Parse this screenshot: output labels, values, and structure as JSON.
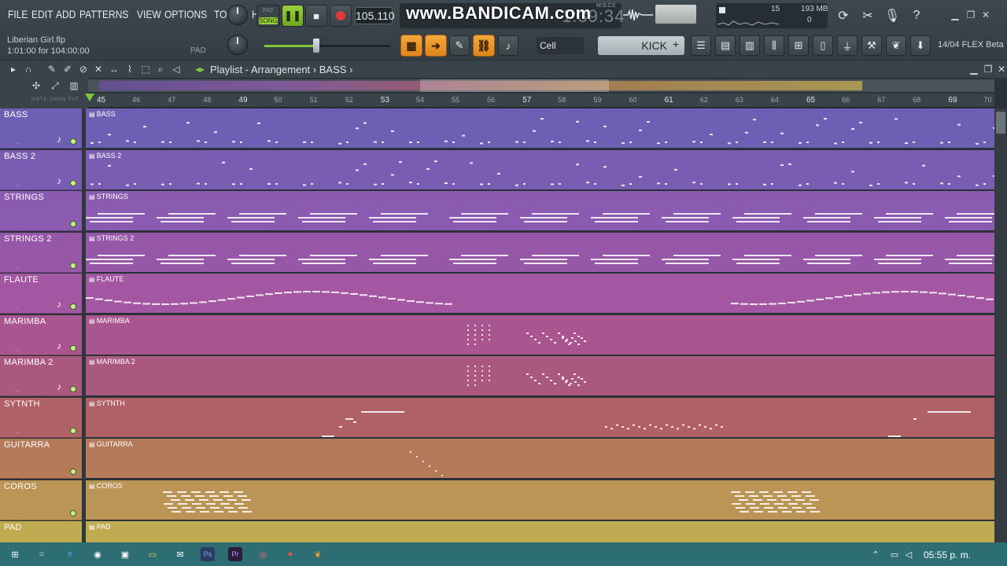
{
  "menu": [
    "FILE",
    "EDIT",
    "ADD",
    "PATTERNS",
    "VIEW",
    "OPTIONS",
    "TOOLS",
    "HELP"
  ],
  "hint": {
    "file": "Liberian Girl.flp",
    "time": "1:01:00 for 104:00:00"
  },
  "pad_label": "PAD",
  "transport": {
    "pat": "PAT",
    "song": "SONG",
    "tempo": "105.110"
  },
  "recorder_watermark": "www.BANDICAM.com",
  "time_display": {
    "digits": "1:39:34",
    "small": "M:S:CS"
  },
  "cpu": {
    "value": "15",
    "memory": "193 MB",
    "polyphony": "0"
  },
  "snap": "Cell",
  "pattern": {
    "name": "KICK"
  },
  "version": "14/04  FLEX Beta",
  "playlist": {
    "title": "Playlist - Arrangement",
    "separator": "›",
    "pattern": "BASS"
  },
  "ruler": {
    "bars": [
      "45",
      "46",
      "47",
      "48",
      "49",
      "50",
      "51",
      "52",
      "53",
      "54",
      "55",
      "56",
      "57",
      "58",
      "59",
      "60",
      "61",
      "62",
      "63",
      "64",
      "65",
      "66",
      "67",
      "68",
      "69",
      "70"
    ],
    "major": [
      "45",
      "49",
      "53",
      "57",
      "61",
      "65",
      "69"
    ]
  },
  "header_legend": "NOTE  CHAN  PAT",
  "tracks": [
    {
      "name": "BASS",
      "clip": "BASS",
      "color": "#6f5fb4",
      "note_icon": true
    },
    {
      "name": "BASS 2",
      "clip": "BASS 2",
      "color": "#7a5db3",
      "note_icon": true
    },
    {
      "name": "STRINGS",
      "clip": "STRINGS",
      "color": "#8a5bb0",
      "note_icon": false
    },
    {
      "name": "STRINGS 2",
      "clip": "STRINGS 2",
      "color": "#9657a8",
      "note_icon": false
    },
    {
      "name": "FLAUTE",
      "clip": "FLAUTE",
      "color": "#a356a2",
      "note_icon": true
    },
    {
      "name": "MARIMBA",
      "clip": "MARIMBA",
      "color": "#a95690",
      "note_icon": true
    },
    {
      "name": "MARIMBA 2",
      "clip": "MARIMBA 2",
      "color": "#ab5880",
      "note_icon": true
    },
    {
      "name": "SYTNTH",
      "clip": "SYTNTH",
      "color": "#b06166",
      "note_icon": false
    },
    {
      "name": "GUITARRA",
      "clip": "GUITARRA",
      "color": "#b57a5a",
      "note_icon": false
    },
    {
      "name": "COROS",
      "clip": "COROS",
      "color": "#bb9555",
      "note_icon": false
    },
    {
      "name": "PAD",
      "clip": "PAD",
      "color": "#c0ab52",
      "note_icon": false
    }
  ],
  "taskbar": {
    "clock": "05:55 p. m."
  }
}
